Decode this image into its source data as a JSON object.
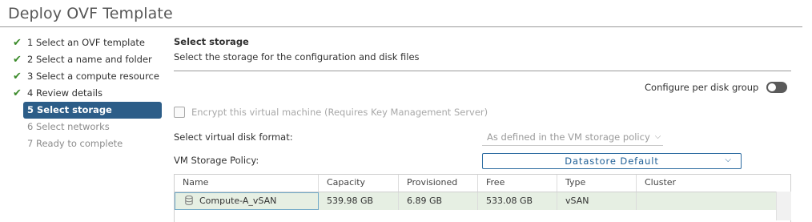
{
  "dialog": {
    "title": "Deploy OVF Template"
  },
  "steps": [
    {
      "label": "1 Select an OVF template",
      "state": "done"
    },
    {
      "label": "2 Select a name and folder",
      "state": "done"
    },
    {
      "label": "3 Select a compute resource",
      "state": "done"
    },
    {
      "label": "4 Review details",
      "state": "done"
    },
    {
      "label": "5 Select storage",
      "state": "active"
    },
    {
      "label": "6 Select networks",
      "state": "future"
    },
    {
      "label": "7 Ready to complete",
      "state": "future"
    }
  ],
  "section": {
    "title": "Select storage",
    "description": "Select the storage for the configuration and disk files"
  },
  "per_disk_toggle": {
    "label": "Configure per disk group",
    "on": false
  },
  "encrypt": {
    "label": "Encrypt this virtual machine (Requires Key Management Server)",
    "checked": false,
    "disabled": true
  },
  "disk_format": {
    "label": "Select virtual disk format:",
    "value": "As defined in the VM storage policy"
  },
  "storage_policy": {
    "label": "VM Storage Policy:",
    "value": "Datastore Default"
  },
  "table": {
    "columns": [
      "Name",
      "Capacity",
      "Provisioned",
      "Free",
      "Type",
      "Cluster"
    ],
    "rows": [
      {
        "name": "Compute-A_vSAN",
        "capacity": "539.98 GB",
        "provisioned": "6.89 GB",
        "free": "533.08 GB",
        "type": "vSAN",
        "cluster": ""
      }
    ]
  },
  "icons": {
    "check": "check-icon",
    "chevron": "chevron-down-icon",
    "datastore": "datastore-icon"
  },
  "colors": {
    "active_step_bg": "#2c5d88",
    "check_green": "#3c8b2b",
    "selected_row": "#e6efe3",
    "policy_border": "#2c6ba0"
  }
}
